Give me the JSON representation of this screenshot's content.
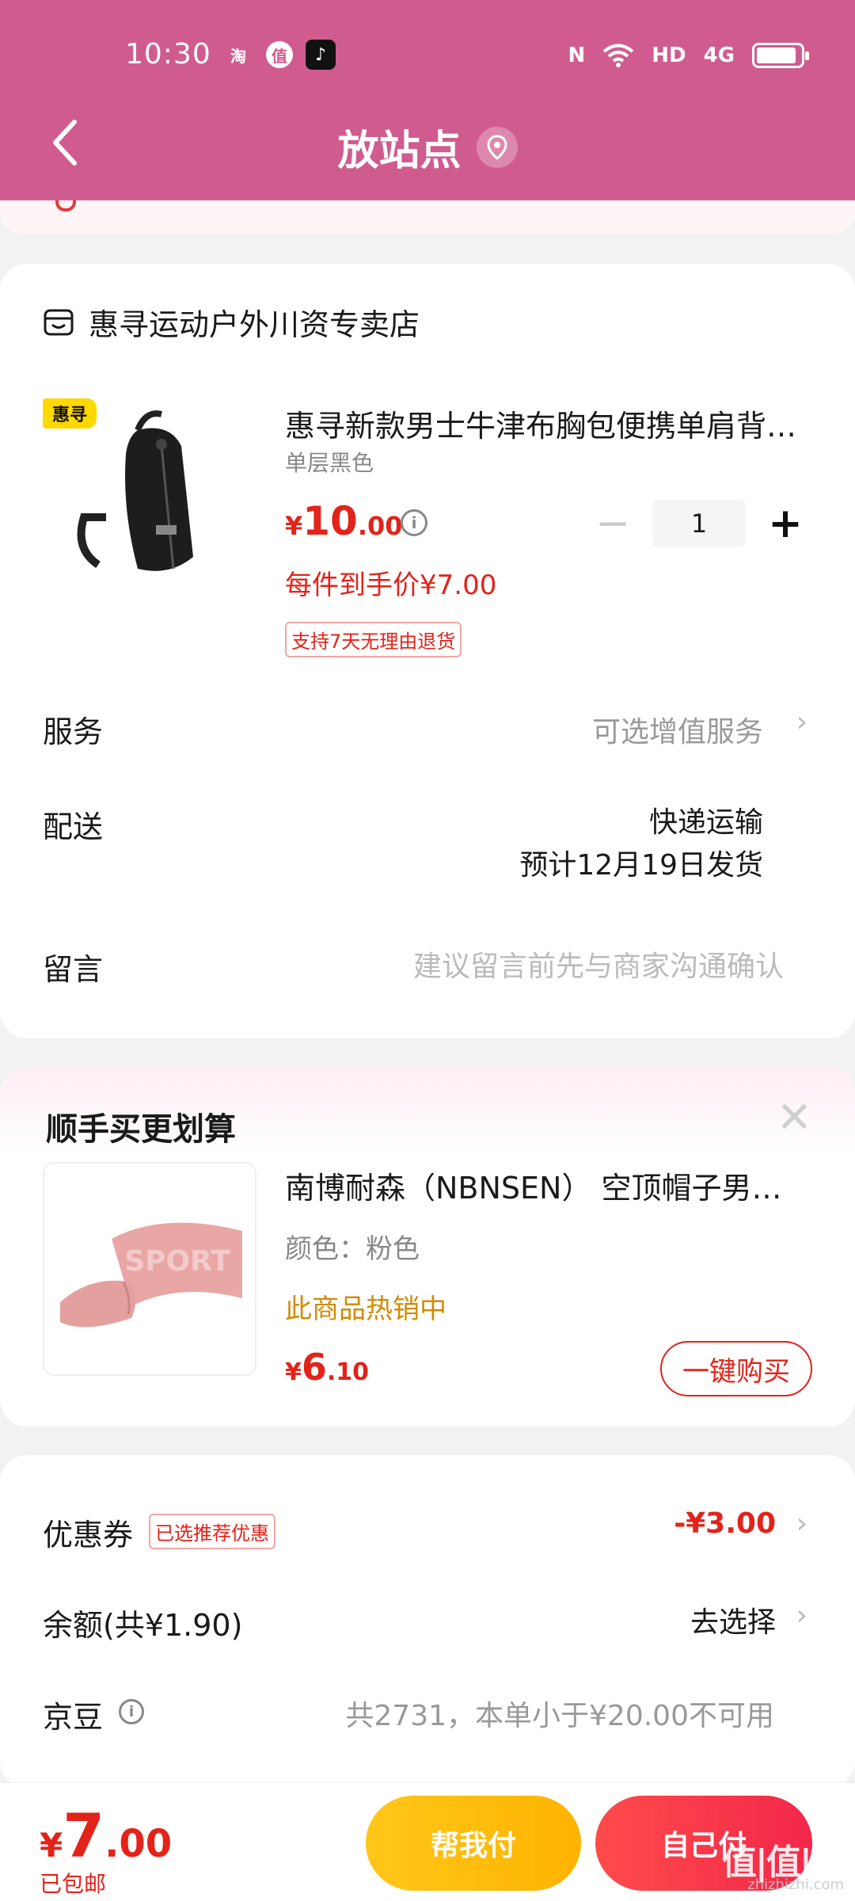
{
  "status_bar": {
    "time": "10:30",
    "app_icons": [
      "淘",
      "值",
      "♪"
    ],
    "sys_icons": [
      "N",
      "HD",
      "4G"
    ],
    "battery_level": 0.9
  },
  "header": {
    "title": "放站点",
    "back_icon": "chevron-left-icon",
    "location_icon": "location-pin-icon"
  },
  "store": {
    "name": "惠寻运动户外川资专卖店",
    "product": {
      "tag": "惠寻",
      "title": "惠寻新款男士牛津布胸包便携单肩背…",
      "spec": "单层黑色",
      "price_currency": "¥",
      "price_int": "10",
      "price_dec": ".00",
      "final_price": "每件到手价¥7.00",
      "return_policy": "支持7天无理由退货",
      "quantity": "1",
      "minus": "−",
      "plus": "+"
    },
    "service_label": "服务",
    "service_value": "可选增值服务",
    "delivery_label": "配送",
    "delivery_method": "快递运输",
    "delivery_date": "预计12月19日发货",
    "note_label": "留言",
    "note_placeholder": "建议留言前先与商家沟通确认"
  },
  "cross_sell": {
    "title": "顺手买更划算",
    "close": "✕",
    "product_title": "南博耐森（NBNSEN） 空顶帽子男…",
    "spec": "颜色：粉色",
    "hot": "此商品热销中",
    "price_currency": "¥",
    "price_int": "6",
    "price_dec": ".10",
    "buy_label": "一键购买",
    "image_text": "SPORT"
  },
  "payment": {
    "coupon_label": "优惠券",
    "coupon_tag": "已选推荐优惠",
    "coupon_value": "-¥3.00",
    "balance_label": "余额(共¥1.90)",
    "balance_action": "去选择",
    "beans_label": "京豆",
    "beans_note": "共2731，本单小于¥20.00不可用",
    "chevron": "›"
  },
  "bottom_bar": {
    "total_currency": "¥",
    "total_int": "7",
    "total_dec": ".00",
    "free_shipping": "已包邮",
    "help_pay": "帮我付",
    "self_pay": "自己付",
    "watermark": "值|值|值",
    "watermark_sub": "zhizhizhi.com"
  },
  "colors": {
    "header": "#d05c8f",
    "price_red": "#e2231a",
    "help_pay": "#ffb300",
    "self_pay": "#f2274a",
    "hot_orange": "#d18b00"
  }
}
